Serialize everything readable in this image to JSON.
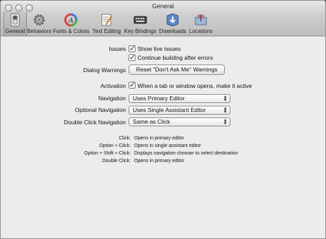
{
  "window": {
    "title": "General"
  },
  "toolbar": {
    "tabs": [
      {
        "label": "General",
        "icon": "switch-icon",
        "selected": true
      },
      {
        "label": "Behaviors",
        "icon": "gear-icon",
        "selected": false
      },
      {
        "label": "Fonts & Colors",
        "icon": "font-color-icon",
        "selected": false
      },
      {
        "label": "Text Editing",
        "icon": "text-editing-icon",
        "selected": false
      },
      {
        "label": "Key Bindings",
        "icon": "keyboard-icon",
        "selected": false
      },
      {
        "label": "Downloads",
        "icon": "downloads-icon",
        "selected": false
      },
      {
        "label": "Locations",
        "icon": "locations-icon",
        "selected": false
      }
    ]
  },
  "issues": {
    "label": "Issues",
    "show_live": {
      "text": "Show live issues",
      "checked": true
    },
    "continue_building": {
      "text": "Continue building after errors",
      "checked": true
    }
  },
  "dialog_warnings": {
    "label": "Dialog Warnings",
    "button": "Reset \"Don't Ask Me\" Warnings"
  },
  "activation": {
    "label": "Activation",
    "checkbox": {
      "text": "When a tab or window opens, make it active",
      "checked": true
    }
  },
  "navigation": {
    "label": "Navigation",
    "value": "Uses Primary Editor"
  },
  "optional_navigation": {
    "label": "Optional Navigation",
    "value": "Uses Single Assistant Editor"
  },
  "double_click_navigation": {
    "label": "Double Click Navigation",
    "value": "Same as Click"
  },
  "help": [
    {
      "key": "Click:",
      "desc": "Opens in primary editor"
    },
    {
      "key": "Option + Click:",
      "desc": "Opens in single assistant editor"
    },
    {
      "key": "Option + Shift + Click:",
      "desc": "Displays navigation chooser to select destination"
    },
    {
      "key": "Double Click:",
      "desc": "Opens in primary editor"
    }
  ]
}
